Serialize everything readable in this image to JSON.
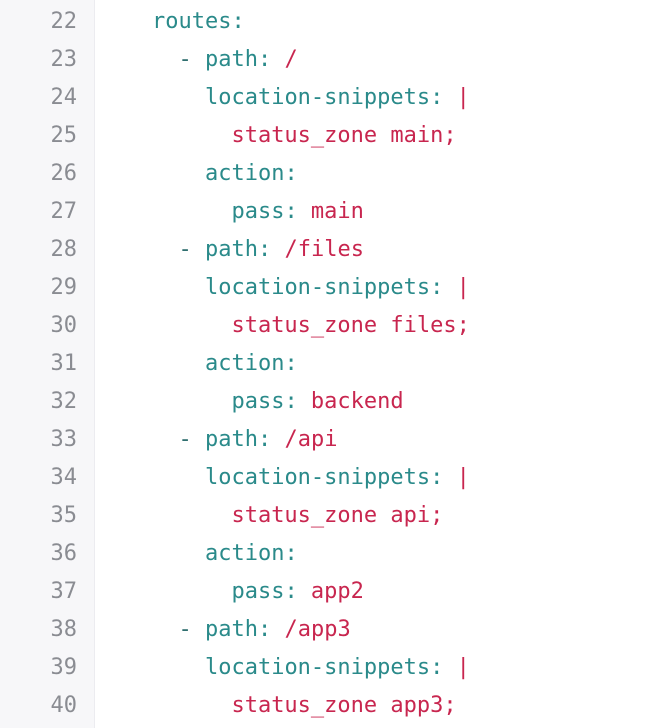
{
  "lines": [
    {
      "num": "22",
      "indent": "    ",
      "dash": "",
      "key": "routes",
      "colon": ":",
      "value": ""
    },
    {
      "num": "23",
      "indent": "      ",
      "dash": "- ",
      "key": "path",
      "colon": ":",
      "value": " /"
    },
    {
      "num": "24",
      "indent": "        ",
      "dash": "",
      "key": "location-snippets",
      "colon": ":",
      "value": " |"
    },
    {
      "num": "25",
      "indent": "          ",
      "dash": "",
      "key": "",
      "colon": "",
      "value": "status_zone main;"
    },
    {
      "num": "26",
      "indent": "        ",
      "dash": "",
      "key": "action",
      "colon": ":",
      "value": ""
    },
    {
      "num": "27",
      "indent": "          ",
      "dash": "",
      "key": "pass",
      "colon": ":",
      "value": " main"
    },
    {
      "num": "28",
      "indent": "      ",
      "dash": "- ",
      "key": "path",
      "colon": ":",
      "value": " /files"
    },
    {
      "num": "29",
      "indent": "        ",
      "dash": "",
      "key": "location-snippets",
      "colon": ":",
      "value": " |"
    },
    {
      "num": "30",
      "indent": "          ",
      "dash": "",
      "key": "",
      "colon": "",
      "value": "status_zone files;"
    },
    {
      "num": "31",
      "indent": "        ",
      "dash": "",
      "key": "action",
      "colon": ":",
      "value": ""
    },
    {
      "num": "32",
      "indent": "          ",
      "dash": "",
      "key": "pass",
      "colon": ":",
      "value": " backend"
    },
    {
      "num": "33",
      "indent": "      ",
      "dash": "- ",
      "key": "path",
      "colon": ":",
      "value": " /api"
    },
    {
      "num": "34",
      "indent": "        ",
      "dash": "",
      "key": "location-snippets",
      "colon": ":",
      "value": " |"
    },
    {
      "num": "35",
      "indent": "          ",
      "dash": "",
      "key": "",
      "colon": "",
      "value": "status_zone api;"
    },
    {
      "num": "36",
      "indent": "        ",
      "dash": "",
      "key": "action",
      "colon": ":",
      "value": ""
    },
    {
      "num": "37",
      "indent": "          ",
      "dash": "",
      "key": "pass",
      "colon": ":",
      "value": " app2"
    },
    {
      "num": "38",
      "indent": "      ",
      "dash": "- ",
      "key": "path",
      "colon": ":",
      "value": " /app3"
    },
    {
      "num": "39",
      "indent": "        ",
      "dash": "",
      "key": "location-snippets",
      "colon": ":",
      "value": " |"
    },
    {
      "num": "40",
      "indent": "          ",
      "dash": "",
      "key": "",
      "colon": "",
      "value": "status_zone app3;"
    }
  ]
}
